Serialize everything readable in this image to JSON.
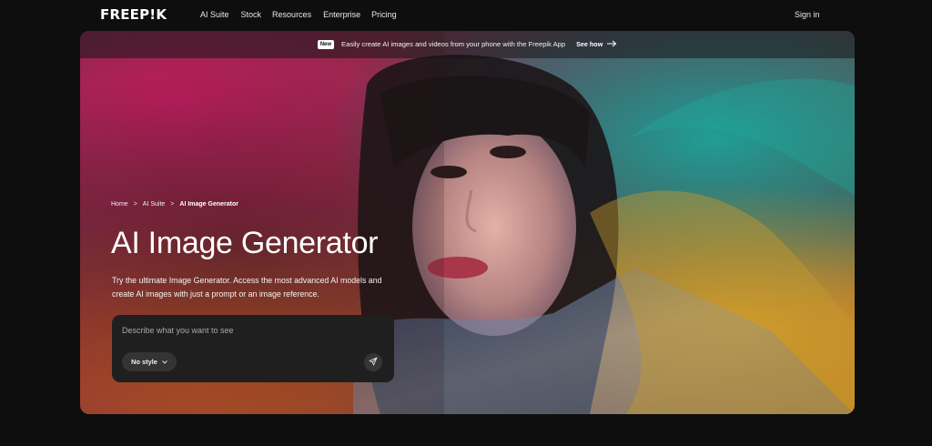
{
  "brand": {
    "logo_text": "FREEP!K"
  },
  "nav": {
    "links": [
      "AI Suite",
      "Stock",
      "Resources",
      "Enterprise",
      "Pricing"
    ],
    "signin_label": "Sign in"
  },
  "announcement": {
    "badge": "New",
    "text": "Easily create AI images and videos from your phone with the Freepik App",
    "cta": "See how"
  },
  "breadcrumb": {
    "items": [
      "Home",
      "AI Suite",
      "AI Image Generator"
    ],
    "separator": ">"
  },
  "hero": {
    "title": "AI Image Generator",
    "subtitle": "Try the ultimate Image Generator. Access the most advanced AI models and create AI images with just a prompt or an image reference."
  },
  "prompt": {
    "placeholder": "Describe what you want to see",
    "value": "",
    "style_label": "No style"
  },
  "icons": {
    "arrow": "arrow-right-icon",
    "chevron": "chevron-down-icon",
    "send": "send-icon"
  },
  "colors": {
    "page_bg": "#0e0e0e",
    "prompt_bg": "#1f1f1f",
    "pill_bg": "#343434",
    "badge_bg": "#ffffff"
  }
}
